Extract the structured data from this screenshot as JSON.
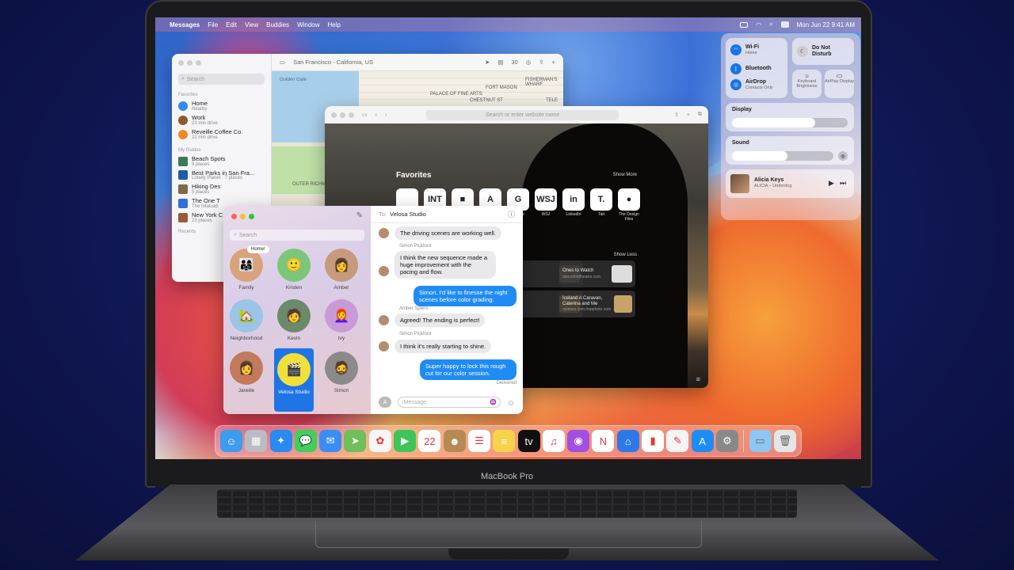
{
  "menubar": {
    "apple_icon": "apple-logo-icon",
    "items": [
      "Messages",
      "File",
      "Edit",
      "View",
      "Buddies",
      "Window",
      "Help"
    ],
    "date_time": "Mon Jun 22  9:41 AM"
  },
  "maps": {
    "search_placeholder": "Search",
    "favorites_header": "Favorites",
    "favorites": [
      {
        "title": "Home",
        "subtitle": "Nearby",
        "color": "#2f8cf0"
      },
      {
        "title": "Work",
        "subtitle": "23 min drive",
        "color": "#8b5a2b"
      },
      {
        "title": "Reveille Coffee Co.",
        "subtitle": "22 min drive",
        "color": "#f08a24"
      }
    ],
    "guides_header": "My Guides",
    "guides": [
      {
        "title": "Beach Spots",
        "subtitle": "9 places"
      },
      {
        "title": "Best Parks in San Fra...",
        "subtitle": "Lonely Planet · 7 places"
      },
      {
        "title": "Hiking Des",
        "subtitle": "5 places"
      },
      {
        "title": "The One T",
        "subtitle": "The Infatuati"
      },
      {
        "title": "New York C",
        "subtitle": "23 places"
      }
    ],
    "recents_header": "Recents",
    "location": "San Francisco - California, US",
    "zoom": "30",
    "map_labels": [
      "Golden Gate",
      "PALACE OF FINE ARTS",
      "FORT MASON",
      "FISHERMAN'S WHARF",
      "CHESTNUT ST",
      "OUTER RICHMOND",
      "TELE"
    ]
  },
  "safari": {
    "address_placeholder": "Search or enter website name",
    "favorites_title": "Favorites",
    "show_more": "Show More",
    "show_less": "Show Less",
    "favorites": [
      {
        "label": "Apple",
        "glyph": ""
      },
      {
        "label": "It's Nice That",
        "glyph": "INT"
      },
      {
        "label": "Patchwork Architecture",
        "glyph": "■"
      },
      {
        "label": "Ace Hotel",
        "glyph": "A"
      },
      {
        "label": "Google",
        "glyph": "G"
      },
      {
        "label": "WSJ",
        "glyph": "WSJ"
      },
      {
        "label": "LinkedIn",
        "glyph": "in"
      },
      {
        "label": "Tait",
        "glyph": "T."
      },
      {
        "label": "The Design Files",
        "glyph": "●"
      }
    ],
    "reading_list": [
      {
        "title": "en",
        "subtitle": ""
      },
      {
        "title": "Ones to Watch",
        "subtitle": "dancefoldtheatre.com"
      },
      {
        "title": "",
        "subtitle": ""
      },
      {
        "title": "Iceland A Caravan, Caterina and Me",
        "subtitle": "nytimes.com.hopphoto.com"
      }
    ]
  },
  "control_center": {
    "wifi": {
      "label": "Wi-Fi",
      "sub": "Home"
    },
    "bluetooth": {
      "label": "Bluetooth"
    },
    "airdrop": {
      "label": "AirDrop",
      "sub": "Contacts Only"
    },
    "dnd": {
      "label": "Do Not Disturb"
    },
    "keyboard": {
      "label": "Keyboard Brightness"
    },
    "airplay": {
      "label": "AirPlay Display"
    },
    "display_label": "Display",
    "display_level": 0.72,
    "sound_label": "Sound",
    "sound_level": 0.55,
    "now_playing": {
      "title": "Alicia Keys",
      "sub": "ALICIA – Underdog"
    }
  },
  "messages": {
    "search_placeholder": "Search",
    "to_label": "To:",
    "recipient": "Velosa Studio",
    "pins": [
      {
        "name": "Family",
        "emoji": "👨‍👩‍👧",
        "bg": "#d9a27a",
        "badge": "Home!"
      },
      {
        "name": "Kristen",
        "emoji": "🙂",
        "bg": "#7cc67a"
      },
      {
        "name": "Amber",
        "emoji": "👩",
        "bg": "#c69a7a"
      },
      {
        "name": "Neighborhood",
        "emoji": "🏡",
        "bg": "#9ac4e8"
      },
      {
        "name": "Kevin",
        "emoji": "🧑",
        "bg": "#6a8a6a"
      },
      {
        "name": "Ivy",
        "emoji": "👩‍🦰",
        "bg": "#c99ad8"
      },
      {
        "name": "Janelle",
        "emoji": "👩",
        "bg": "#c27a5a"
      },
      {
        "name": "Velosa Studio",
        "emoji": "🎬",
        "bg": "#f2e03a"
      },
      {
        "name": "Simon",
        "emoji": "🧔",
        "bg": "#8a8a8a"
      }
    ],
    "conversation": [
      {
        "dir": "in",
        "sender": "",
        "text": "The driving scenes are working well."
      },
      {
        "dir": "in",
        "sender": "Simon Pickford",
        "text": "I think the new sequence made a huge improvement with the pacing and flow."
      },
      {
        "dir": "out",
        "sender": "",
        "text": "Simon, I'd like to finesse the night scenes before color grading."
      },
      {
        "dir": "in",
        "sender": "Amber Spiers",
        "text": "Agreed! The ending is perfect!"
      },
      {
        "dir": "in",
        "sender": "Simon Pickford",
        "text": "I think it's really starting to shine."
      },
      {
        "dir": "out",
        "sender": "",
        "text": "Super happy to lock this rough cut for our color session."
      }
    ],
    "delivered": "Delivered",
    "compose_placeholder": "iMessage"
  },
  "dock": {
    "apps": [
      {
        "name": "Finder",
        "color": "#3d9bf0",
        "glyph": "☺"
      },
      {
        "name": "Launchpad",
        "color": "#bbbbc5",
        "glyph": "▦"
      },
      {
        "name": "Safari",
        "color": "#2a8af0",
        "glyph": "✦"
      },
      {
        "name": "Messages",
        "color": "#3fcf5a",
        "glyph": "💬"
      },
      {
        "name": "Mail",
        "color": "#3a8df5",
        "glyph": "✉"
      },
      {
        "name": "Maps",
        "color": "#6fbf5a",
        "glyph": "➤"
      },
      {
        "name": "Photos",
        "color": "#f6f6f6",
        "glyph": "✿"
      },
      {
        "name": "FaceTime",
        "color": "#3ec55a",
        "glyph": "▶"
      },
      {
        "name": "Calendar",
        "color": "#ffffff",
        "glyph": "22"
      },
      {
        "name": "Contacts",
        "color": "#b68a55",
        "glyph": "☻"
      },
      {
        "name": "Reminders",
        "color": "#ffffff",
        "glyph": "☰"
      },
      {
        "name": "Notes",
        "color": "#f7d34a",
        "glyph": "≡"
      },
      {
        "name": "TV",
        "color": "#111111",
        "glyph": "tv"
      },
      {
        "name": "Music",
        "color": "#ffffff",
        "glyph": "♫"
      },
      {
        "name": "Podcasts",
        "color": "#a24ee0",
        "glyph": "◉"
      },
      {
        "name": "News",
        "color": "#ffffff",
        "glyph": "N"
      },
      {
        "name": "Keynote",
        "color": "#2b7ae8",
        "glyph": "⌂"
      },
      {
        "name": "Numbers",
        "color": "#ffffff",
        "glyph": "▮"
      },
      {
        "name": "Pages",
        "color": "#f4f4f4",
        "glyph": "✎"
      },
      {
        "name": "App Store",
        "color": "#1d8cf5",
        "glyph": "A"
      },
      {
        "name": "System Preferences",
        "color": "#888888",
        "glyph": "⚙"
      }
    ],
    "trailing": [
      {
        "name": "Downloads Folder",
        "color": "#8ec6f3",
        "glyph": "▭"
      },
      {
        "name": "Trash",
        "color": "#e5e5e5",
        "glyph": "🗑"
      }
    ]
  },
  "device": {
    "brand": "MacBook Pro"
  }
}
